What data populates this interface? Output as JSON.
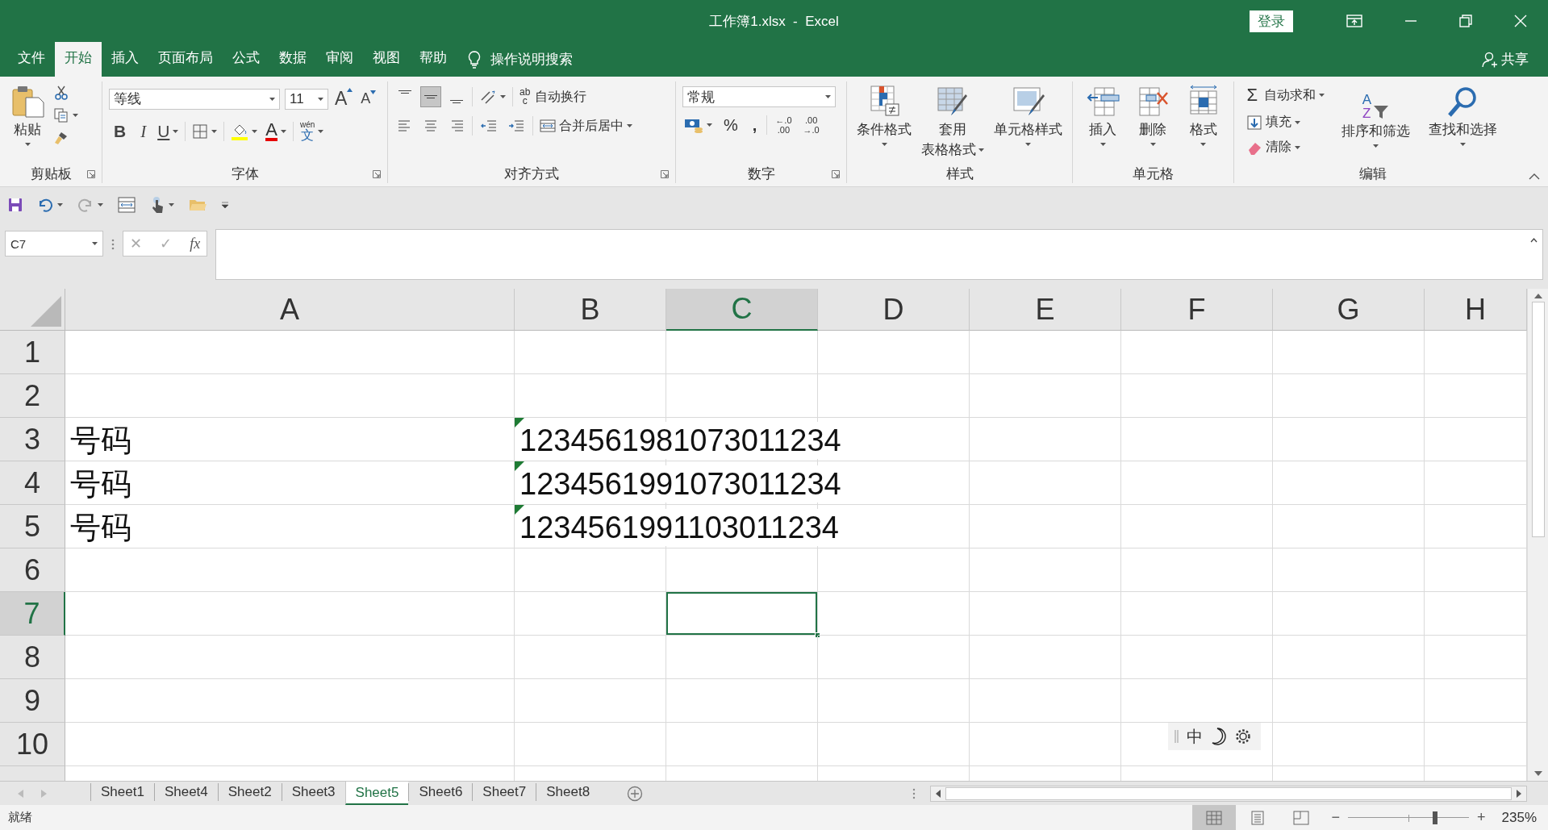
{
  "window": {
    "title": "工作簿1.xlsx  -  Excel",
    "sign_in": "登录"
  },
  "menu": [
    {
      "label": "文件",
      "selected": false
    },
    {
      "label": "开始",
      "selected": true
    },
    {
      "label": "插入",
      "selected": false
    },
    {
      "label": "页面布局",
      "selected": false
    },
    {
      "label": "公式",
      "selected": false
    },
    {
      "label": "数据",
      "selected": false
    },
    {
      "label": "审阅",
      "selected": false
    },
    {
      "label": "视图",
      "selected": false
    },
    {
      "label": "帮助",
      "selected": false
    }
  ],
  "tell_me": "操作说明搜索",
  "share": "共享",
  "ribbon": [
    {
      "kind": "clipboard",
      "label": "剪贴板",
      "launcher": true,
      "paste": "粘贴"
    },
    {
      "kind": "font",
      "label": "字体",
      "launcher": true,
      "font": "等线",
      "size": "11",
      "grow": "A",
      "shrink": "A",
      "bold": "B",
      "italic": "I",
      "underline": "U",
      "font_color": "A",
      "phonetic_top": "wén",
      "phonetic": "文"
    },
    {
      "kind": "alignment",
      "label": "对齐方式",
      "launcher": true,
      "middle_selected": true,
      "wrap_icon": [
        "ab",
        "c"
      ],
      "wrap": "自动换行",
      "merge": "合并后居中"
    },
    {
      "kind": "number",
      "label": "数字",
      "launcher": true,
      "format": "常规",
      "percent": "%",
      "comma": ",",
      "increase": [
        "←.0",
        ".00"
      ],
      "decrease": [
        ".00",
        "→.0"
      ]
    },
    {
      "kind": "styles",
      "label": "样式",
      "launcher": false,
      "buttons": [
        [
          "条件格式"
        ],
        [
          "套用",
          "表格格式"
        ],
        [
          "单元格样式"
        ]
      ]
    },
    {
      "kind": "cells",
      "label": "单元格",
      "launcher": false,
      "buttons": [
        "插入",
        "删除",
        "格式"
      ]
    },
    {
      "kind": "editing",
      "label": "编辑",
      "launcher": false,
      "sigma": "Σ",
      "autosum": "自动求和",
      "fill": "填充",
      "clear": "清除",
      "sort_letters": [
        "A",
        "Z"
      ],
      "sort": "排序和筛选",
      "find": "查找和选择"
    }
  ],
  "name_box": "C7",
  "formula_buttons": [
    "✕",
    "✓",
    "fx"
  ],
  "sheet": {
    "columns": [
      {
        "label": "A",
        "selected": false
      },
      {
        "label": "B",
        "selected": false
      },
      {
        "label": "C",
        "selected": true
      },
      {
        "label": "D",
        "selected": false
      },
      {
        "label": "E",
        "selected": false
      },
      {
        "label": "F",
        "selected": false
      },
      {
        "label": "G",
        "selected": false
      },
      {
        "label": "H",
        "selected": false
      }
    ],
    "rows": [
      {
        "label": "1",
        "selected": false
      },
      {
        "label": "2",
        "selected": false
      },
      {
        "label": "3",
        "selected": false,
        "cells": [
          {
            "text": "号码",
            "error": false
          },
          {
            "text": "1234561981073011234",
            "error": true
          }
        ]
      },
      {
        "label": "4",
        "selected": false,
        "cells": [
          {
            "text": "号码",
            "error": false
          },
          {
            "text": "1234561991073011234",
            "error": true
          }
        ]
      },
      {
        "label": "5",
        "selected": false,
        "cells": [
          {
            "text": "号码",
            "error": false
          },
          {
            "text": "1234561991103011234",
            "error": true
          }
        ]
      },
      {
        "label": "6",
        "selected": false
      },
      {
        "label": "7",
        "selected": true
      },
      {
        "label": "8",
        "selected": false
      },
      {
        "label": "9",
        "selected": false
      },
      {
        "label": "10",
        "selected": false
      }
    ]
  },
  "ime_toolbar": {
    "mode": "中"
  },
  "sheet_tabs": [
    {
      "label": "Sheet1",
      "selected": false
    },
    {
      "label": "Sheet4",
      "selected": false
    },
    {
      "label": "Sheet2",
      "selected": false
    },
    {
      "label": "Sheet3",
      "selected": false
    },
    {
      "label": "Sheet5",
      "selected": true
    },
    {
      "label": "Sheet6",
      "selected": false
    },
    {
      "label": "Sheet7",
      "selected": false
    },
    {
      "label": "Sheet8",
      "selected": false
    }
  ],
  "status_bar": {
    "status": "就绪",
    "views": [
      {
        "kind": "normal",
        "selected": true
      },
      {
        "kind": "page_layout",
        "selected": false
      },
      {
        "kind": "page_break",
        "selected": false
      }
    ],
    "zoom_out": "−",
    "zoom_in": "+",
    "zoom": {
      "level": 0.72
    },
    "zoom_label": "235%"
  }
}
